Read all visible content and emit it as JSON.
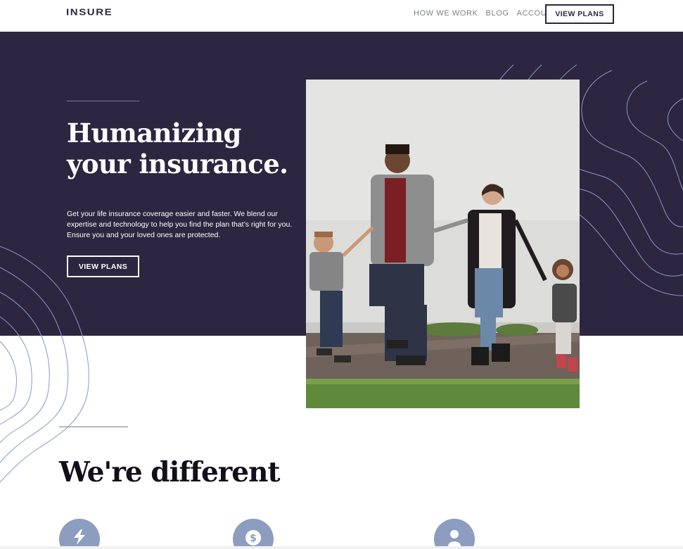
{
  "nav": {
    "logo": "INSURE",
    "links": [
      "HOW WE WORK",
      "BLOG",
      "ACCOUNT"
    ],
    "cta": "VIEW PLANS"
  },
  "hero": {
    "title_line1": "Humanizing",
    "title_line2": "your insurance.",
    "text": "Get your life insurance coverage easier and faster. We blend our expertise and technology to help you find the plan that’s right for you. Ensure you and your loved ones are protected.",
    "cta": "VIEW PLANS",
    "photo": "family-walking-photo"
  },
  "different": {
    "title": "We're different"
  },
  "features": [
    {
      "icon": "lightning-icon"
    },
    {
      "icon": "dollar-icon"
    },
    {
      "icon": "person-icon"
    }
  ],
  "colors": {
    "dark_violet": "#2d2640",
    "grayish_blue": "#8d9dbf",
    "contour_line": "#8c95c8",
    "white": "#ffffff"
  }
}
